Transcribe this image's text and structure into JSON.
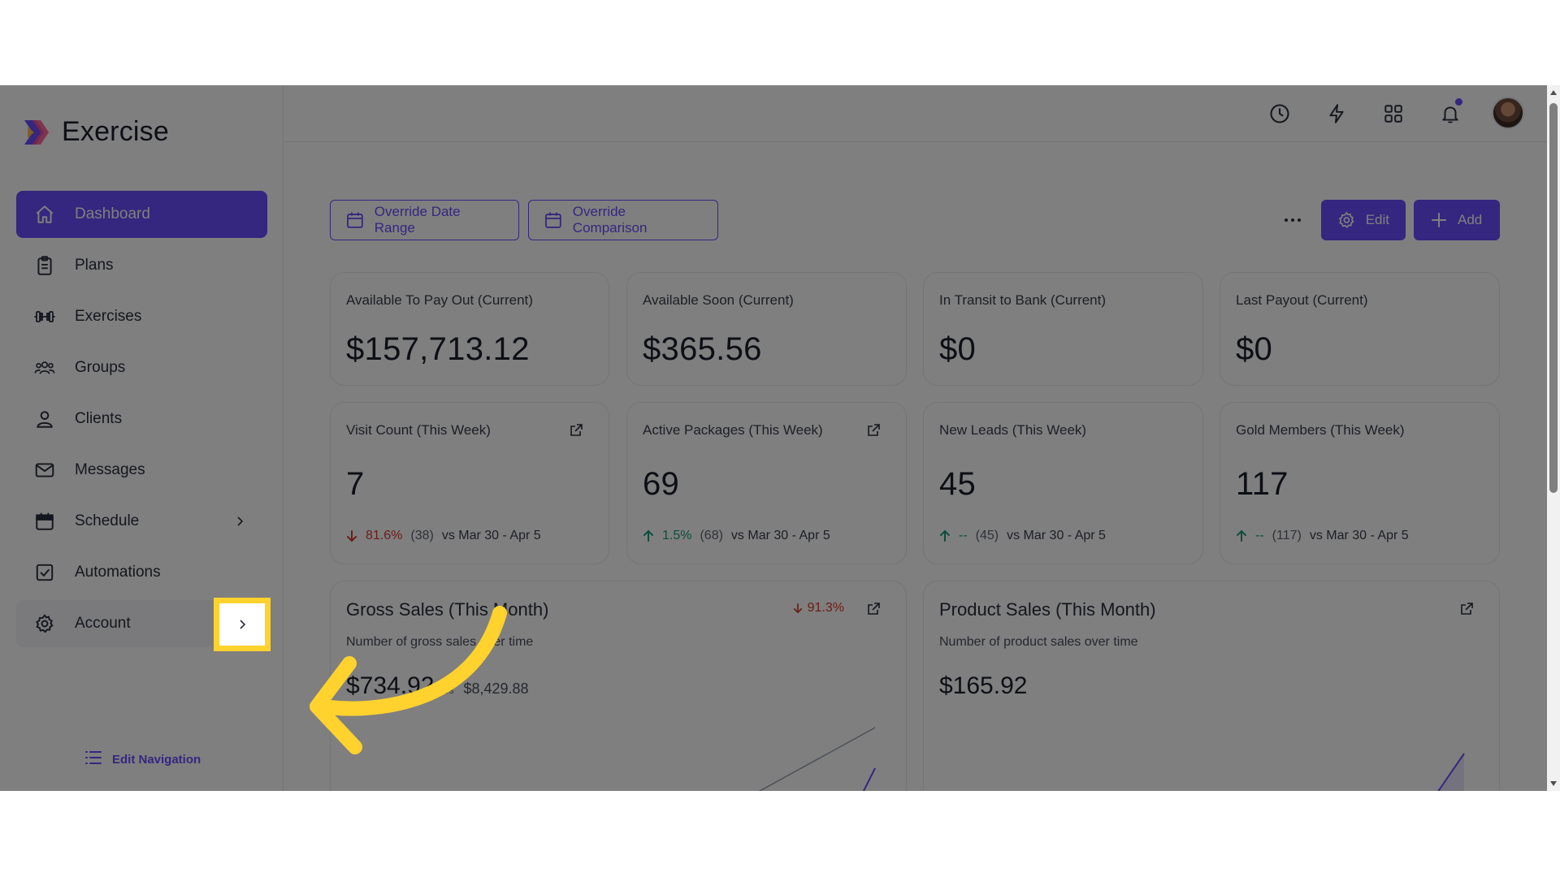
{
  "app": {
    "name": "Exercise"
  },
  "sidebar": {
    "items": [
      {
        "label": "Dashboard",
        "icon": "home-icon",
        "active": true
      },
      {
        "label": "Plans",
        "icon": "clipboard-icon"
      },
      {
        "label": "Exercises",
        "icon": "dumbbell-icon"
      },
      {
        "label": "Groups",
        "icon": "users-group-icon"
      },
      {
        "label": "Clients",
        "icon": "user-icon"
      },
      {
        "label": "Messages",
        "icon": "mail-icon"
      },
      {
        "label": "Schedule",
        "icon": "calendar-icon",
        "has_submenu": true
      },
      {
        "label": "Automations",
        "icon": "checkbox-icon"
      },
      {
        "label": "Account",
        "icon": "gear-icon",
        "has_submenu": true
      }
    ],
    "edit_navigation_label": "Edit Navigation"
  },
  "toolbar": {
    "override_date_range_label": "Override Date Range",
    "override_comparison_label": "Override Comparison",
    "edit_label": "Edit",
    "add_label": "Add"
  },
  "stat_cards": [
    {
      "title": "Available To Pay Out (Current)",
      "value": "$157,713.12"
    },
    {
      "title": "Available Soon (Current)",
      "value": "$365.56"
    },
    {
      "title": "In Transit to Bank (Current)",
      "value": "$0"
    },
    {
      "title": "Last Payout (Current)",
      "value": "$0"
    }
  ],
  "week_cards": [
    {
      "title": "Visit Count (This Week)",
      "value": "7",
      "direction": "down",
      "change": "81.6%",
      "prev": "(38)",
      "comparison": "vs Mar 30 - Apr 5"
    },
    {
      "title": "Active Packages (This Week)",
      "value": "69",
      "direction": "up",
      "change": "1.5%",
      "prev": "(68)",
      "comparison": "vs Mar 30 - Apr 5"
    },
    {
      "title": "New Leads (This Week)",
      "value": "45",
      "direction": "up",
      "change": "--",
      "prev": "(45)",
      "comparison": "vs Mar 30 - Apr 5"
    },
    {
      "title": "Gold Members (This Week)",
      "value": "117",
      "direction": "up",
      "change": "--",
      "prev": "(117)",
      "comparison": "vs Mar 30 - Apr 5"
    }
  ],
  "gross_sales": {
    "title": "Gross Sales (This Month)",
    "change": "91.3%",
    "subtitle": "Number of gross sales over time",
    "amount": "$734.92",
    "vs": "vs",
    "comparison_amount": "$8,429.88"
  },
  "product_sales": {
    "title": "Product Sales (This Month)",
    "subtitle": "Number of product sales over time",
    "amount": "$165.92"
  },
  "colors": {
    "accent": "#6b4cff",
    "negative": "#d93a2f",
    "positive": "#1a9b79",
    "highlight": "#ffd22e"
  }
}
